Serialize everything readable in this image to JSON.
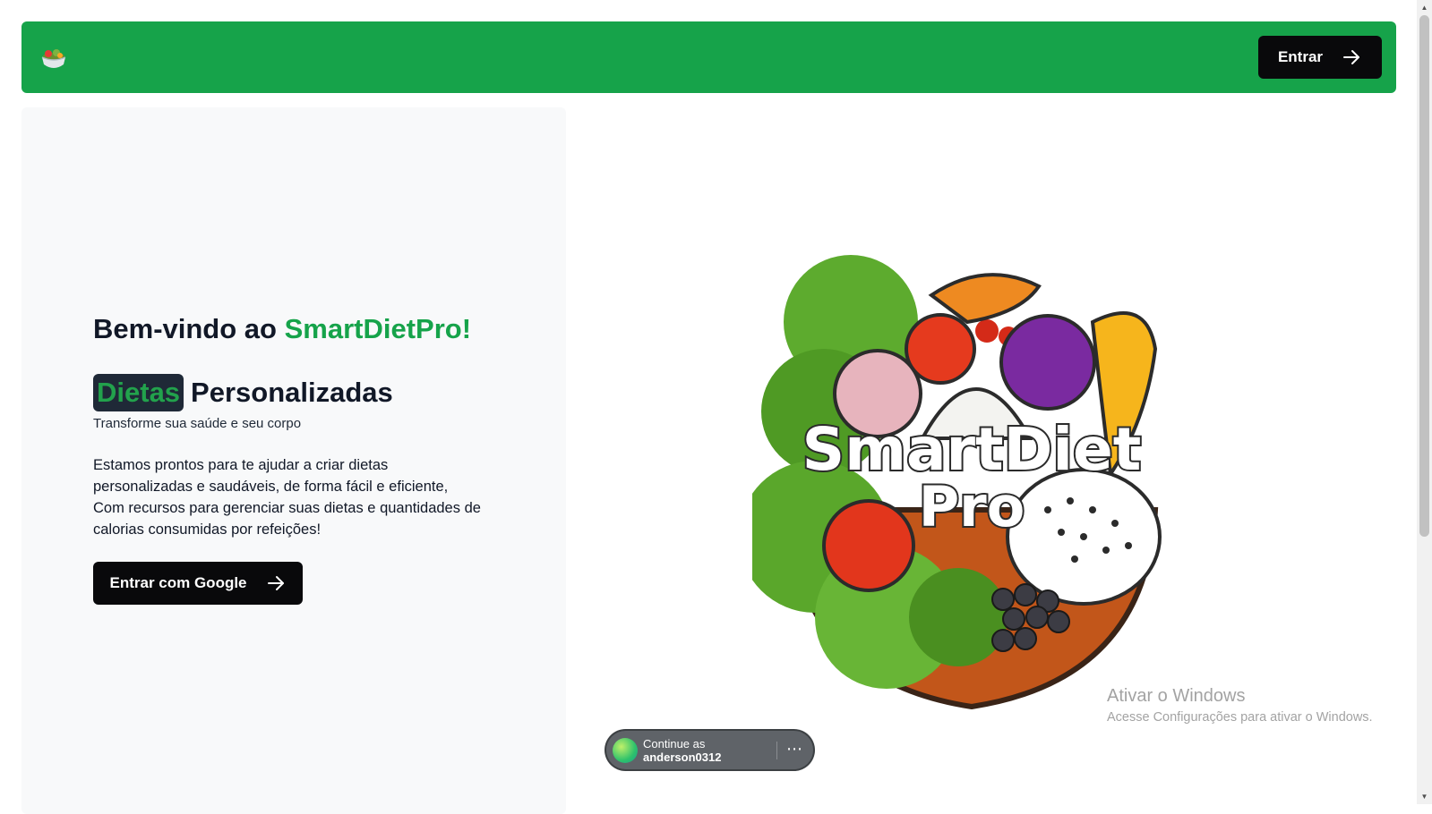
{
  "header": {
    "logo_icon": "salad-bowl-icon",
    "login_label": "Entrar",
    "brand_color": "#16a34a"
  },
  "hero": {
    "welcome_prefix": "Bem-vindo ao",
    "welcome_brand": "SmartDietPro!",
    "badge_word": "Dietas",
    "subtitle_rest": "Personalizadas",
    "tagline": "Transforme sua saúde e seu corpo",
    "description_lines": [
      "Estamos prontos para te ajudar a criar dietas",
      "personalizadas e saudáveis, de forma fácil e eficiente,",
      "Com recursos para gerenciar suas dietas e quantidades de",
      "calorias consumidas por refeições!"
    ],
    "google_button_label": "Entrar com Google",
    "image_text_line1": "SmartDiet",
    "image_text_line2": "Pro"
  },
  "google_prompt": {
    "line1": "Continue as",
    "username": "anderson0312",
    "menu_icon": "more-horizontal-icon"
  },
  "windows_watermark": {
    "title": "Ativar o Windows",
    "subtitle": "Acesse Configurações para ativar o Windows."
  }
}
